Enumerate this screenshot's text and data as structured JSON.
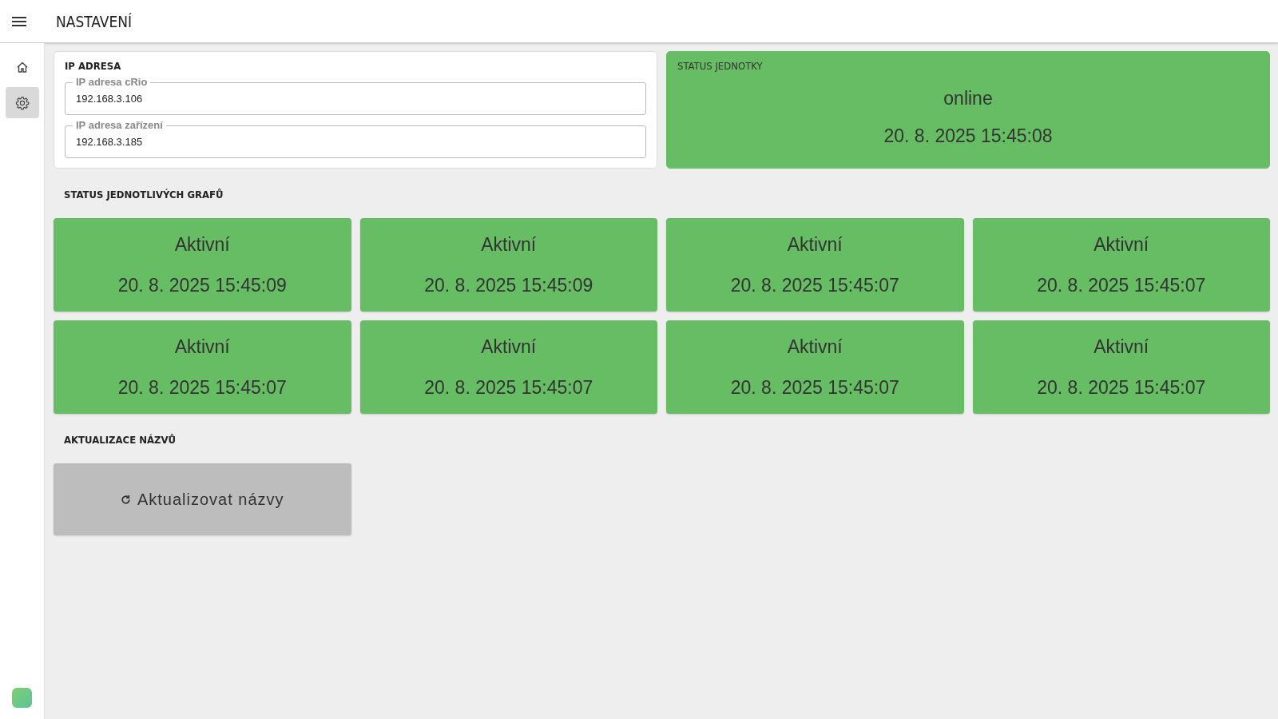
{
  "header": {
    "title": "NASTAVENÍ"
  },
  "sidebar": {
    "items": [
      {
        "kind": "home",
        "selected": false
      },
      {
        "kind": "settings",
        "selected": true
      }
    ]
  },
  "ip_card": {
    "title": "IP ADRESA",
    "fields": [
      {
        "label": "IP adresa cRio",
        "value": "192.168.3.106"
      },
      {
        "label": "IP adresa zařízení",
        "value": "192.168.3.185"
      }
    ]
  },
  "unit_status": {
    "title": "STATUS JEDNOTKY",
    "status": "online",
    "time": "20. 8. 2025 15:45:08"
  },
  "graphs": {
    "title": "STATUS JEDNOTLIVÝCH GRAFŮ",
    "items": [
      {
        "status": "Aktivní",
        "time": "20. 8. 2025 15:45:09"
      },
      {
        "status": "Aktivní",
        "time": "20. 8. 2025 15:45:09"
      },
      {
        "status": "Aktivní",
        "time": "20. 8. 2025 15:45:07"
      },
      {
        "status": "Aktivní",
        "time": "20. 8. 2025 15:45:07"
      },
      {
        "status": "Aktivní",
        "time": "20. 8. 2025 15:45:07"
      },
      {
        "status": "Aktivní",
        "time": "20. 8. 2025 15:45:07"
      },
      {
        "status": "Aktivní",
        "time": "20. 8. 2025 15:45:07"
      },
      {
        "status": "Aktivní",
        "time": "20. 8. 2025 15:45:07"
      }
    ]
  },
  "names": {
    "title": "AKTUALIZACE NÁZVŮ",
    "button": "Aktualizovat názvy"
  }
}
